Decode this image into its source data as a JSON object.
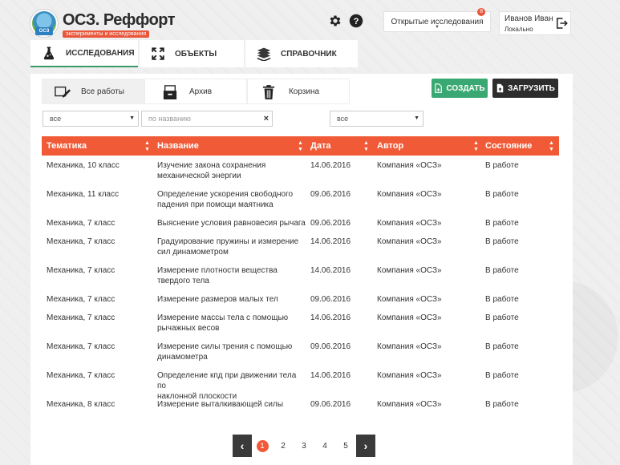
{
  "app": {
    "title": "ОСЗ. Реффорт",
    "subtitle": "эксперименты и исследования",
    "logo_badge": "ОСЗ"
  },
  "header": {
    "open_studies_label": "Открытые исследования",
    "open_studies_count": "8",
    "user_name": "Иванов Иван",
    "user_status": "Локально"
  },
  "main_tabs": [
    {
      "label": "Исследования",
      "icon": "flask-icon"
    },
    {
      "label": "Объекты",
      "icon": "expand-icon"
    },
    {
      "label": "Справочник",
      "icon": "books-icon"
    }
  ],
  "sub_tabs": [
    {
      "label": "Все работы",
      "icon": "edit-icon"
    },
    {
      "label": "Архив",
      "icon": "archive-icon"
    },
    {
      "label": "Корзина",
      "icon": "trash-icon"
    }
  ],
  "actions": {
    "create_label": "Создать",
    "upload_label": "Загрузить"
  },
  "filters": {
    "topic_value": "все",
    "name_placeholder": "по названию",
    "author_value": "все"
  },
  "table": {
    "columns": [
      "Тематика",
      "Название",
      "Дата",
      "Автор",
      "Состояние"
    ],
    "rows": [
      {
        "topic": "Механика, 10 класс",
        "name": [
          "Изучение закона сохранения",
          "механической энергии"
        ],
        "date": "14.06.2016",
        "author": "Компания «ОСЗ»",
        "state": "В работе"
      },
      {
        "topic": "Механика, 11 класс",
        "name": [
          "Определение ускорения свободного",
          "падения при помощи маятника"
        ],
        "date": "09.06.2016",
        "author": "Компания «ОСЗ»",
        "state": "В работе"
      },
      {
        "topic": "Механика, 7 класс",
        "name": [
          "Выяснение условия равновесия рычага"
        ],
        "date": "09.06.2016",
        "author": "Компания «ОСЗ»",
        "state": "В работе"
      },
      {
        "topic": "Механика, 7 класс",
        "name": [
          "Градуирование пружины и измерение",
          "сил динамометром"
        ],
        "date": "14.06.2016",
        "author": "Компания «ОСЗ»",
        "state": "В работе"
      },
      {
        "topic": "Механика, 7 класс",
        "name": [
          "Измерение плотности вещества",
          "твердого тела"
        ],
        "date": "14.06.2016",
        "author": "Компания «ОСЗ»",
        "state": "В работе"
      },
      {
        "topic": "Механика, 7 класс",
        "name": [
          "Измерение размеров малых тел"
        ],
        "date": "09.06.2016",
        "author": "Компания «ОСЗ»",
        "state": "В работе"
      },
      {
        "topic": "Механика, 7 класс",
        "name": [
          "Измерение массы тела с помощью",
          "рычажных весов"
        ],
        "date": "14.06.2016",
        "author": "Компания «ОСЗ»",
        "state": "В работе"
      },
      {
        "topic": "Механика, 7 класс",
        "name": [
          "Измерение силы трения с помощью",
          "динамометра"
        ],
        "date": "09.06.2016",
        "author": "Компания «ОСЗ»",
        "state": "В работе"
      },
      {
        "topic": "Механика, 7 класс",
        "name": [
          "Определение кпд при движении тела по",
          "наклонной плоскости"
        ],
        "date": "14.06.2016",
        "author": "Компания «ОСЗ»",
        "state": "В работе"
      },
      {
        "topic": "Механика, 8 класс",
        "name": [
          "Измерение выталкивающей силы"
        ],
        "date": "09.06.2016",
        "author": "Компания «ОСЗ»",
        "state": "В работе"
      }
    ]
  },
  "pagination": {
    "pages": [
      "1",
      "2",
      "3",
      "4",
      "5"
    ],
    "current": "1",
    "prev_glyph": "‹",
    "next_glyph": "›"
  },
  "colors": {
    "accent": "#f15a37",
    "create": "#3aa872",
    "upload": "#2d2d2d",
    "active_tab_underline": "#3a9a6a"
  }
}
